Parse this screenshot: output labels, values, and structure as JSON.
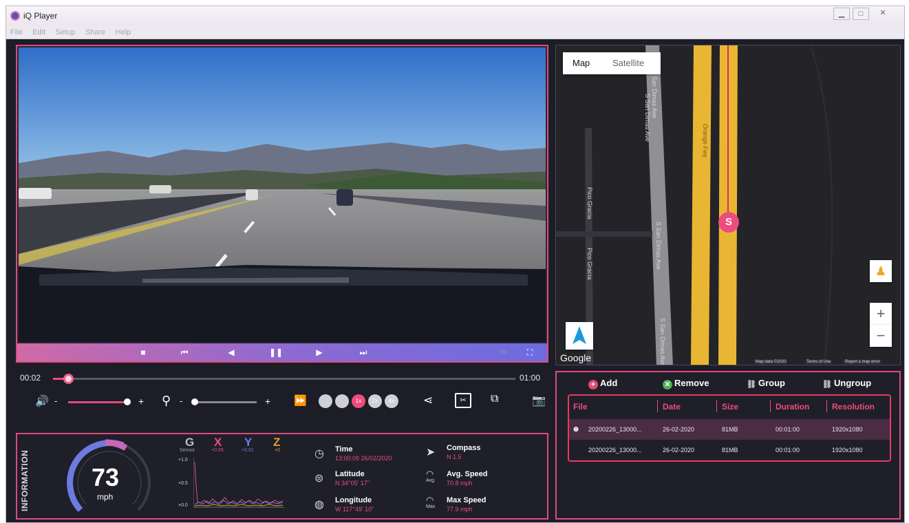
{
  "window": {
    "title": "iQ Player",
    "controls": [
      "minimize",
      "restore",
      "close"
    ]
  },
  "menu": [
    "File",
    "Edit",
    "Setup",
    "Share",
    "Help"
  ],
  "video": {
    "controls": [
      "stop",
      "previous",
      "step-back",
      "pause",
      "step-forward",
      "next",
      "mini",
      "fullscreen"
    ]
  },
  "timeline": {
    "current": "00:02",
    "total": "01:00",
    "progress": 0.033
  },
  "playback": {
    "volume_minus": "-",
    "volume_plus": "+",
    "volume_level": 0.95,
    "zoom_minus": "-",
    "zoom_plus": "+",
    "zoom_level": 0.02,
    "speeds": [
      "",
      "",
      "1x",
      "2x",
      "4x"
    ],
    "active_speed": "1x"
  },
  "info": {
    "title": "INFORMATION",
    "speed": "73",
    "speed_unit": "mph",
    "sensor": {
      "g": "G",
      "g_sub": "Sensor",
      "x": "X",
      "x_sub": "+0.05",
      "y": "Y",
      "y_sub": "+0.01",
      "z": "Z",
      "z_sub": "+0",
      "scale": [
        "+1.0",
        "+0.5",
        "+0.0"
      ]
    },
    "time_label": "Time",
    "time_value": "13:00:09 26/02/2020",
    "lat_label": "Latitude",
    "lat_value": "N 34°05' 17\"",
    "lon_label": "Longitude",
    "lon_value": "W 117°49' 10\"",
    "compass_label": "Compass",
    "compass_value": "N 1.5",
    "avg_label": "Avg. Speed",
    "avg_value": "70.8 mph",
    "avg_sub": "Avg.",
    "max_label": "Max Speed",
    "max_value": "77.9 mph",
    "max_sub": "Max"
  },
  "map": {
    "tab_map": "Map",
    "tab_satellite": "Satellite",
    "zoom_in": "+",
    "zoom_out": "−",
    "google": "Google",
    "marker": "S",
    "streets": [
      "S San Dimas Ave",
      "S San Dimas Ave",
      "S San Dimas Ave",
      "S San Dimas Ave",
      "Orange Fwy",
      "Pico Gracia",
      "Pico Gracia"
    ],
    "footer": [
      "Map data ©2020",
      "Terms of Use",
      "Report a map error"
    ]
  },
  "files": {
    "add": "Add",
    "remove": "Remove",
    "group": "Group",
    "ungroup": "Ungroup",
    "columns": [
      "File",
      "Date",
      "Size",
      "Duration",
      "Resolution"
    ],
    "rows": [
      [
        "20200226_13000...",
        "26-02-2020",
        "81MB",
        "00:01:00",
        "1920x1080"
      ],
      [
        "20200226_13000...",
        "26-02-2020",
        "81MB",
        "00:01:00",
        "1920x1080"
      ]
    ]
  },
  "colors": {
    "accent": "#ef4c7c",
    "panel": "#1c1d27",
    "road": "#f1c232"
  }
}
